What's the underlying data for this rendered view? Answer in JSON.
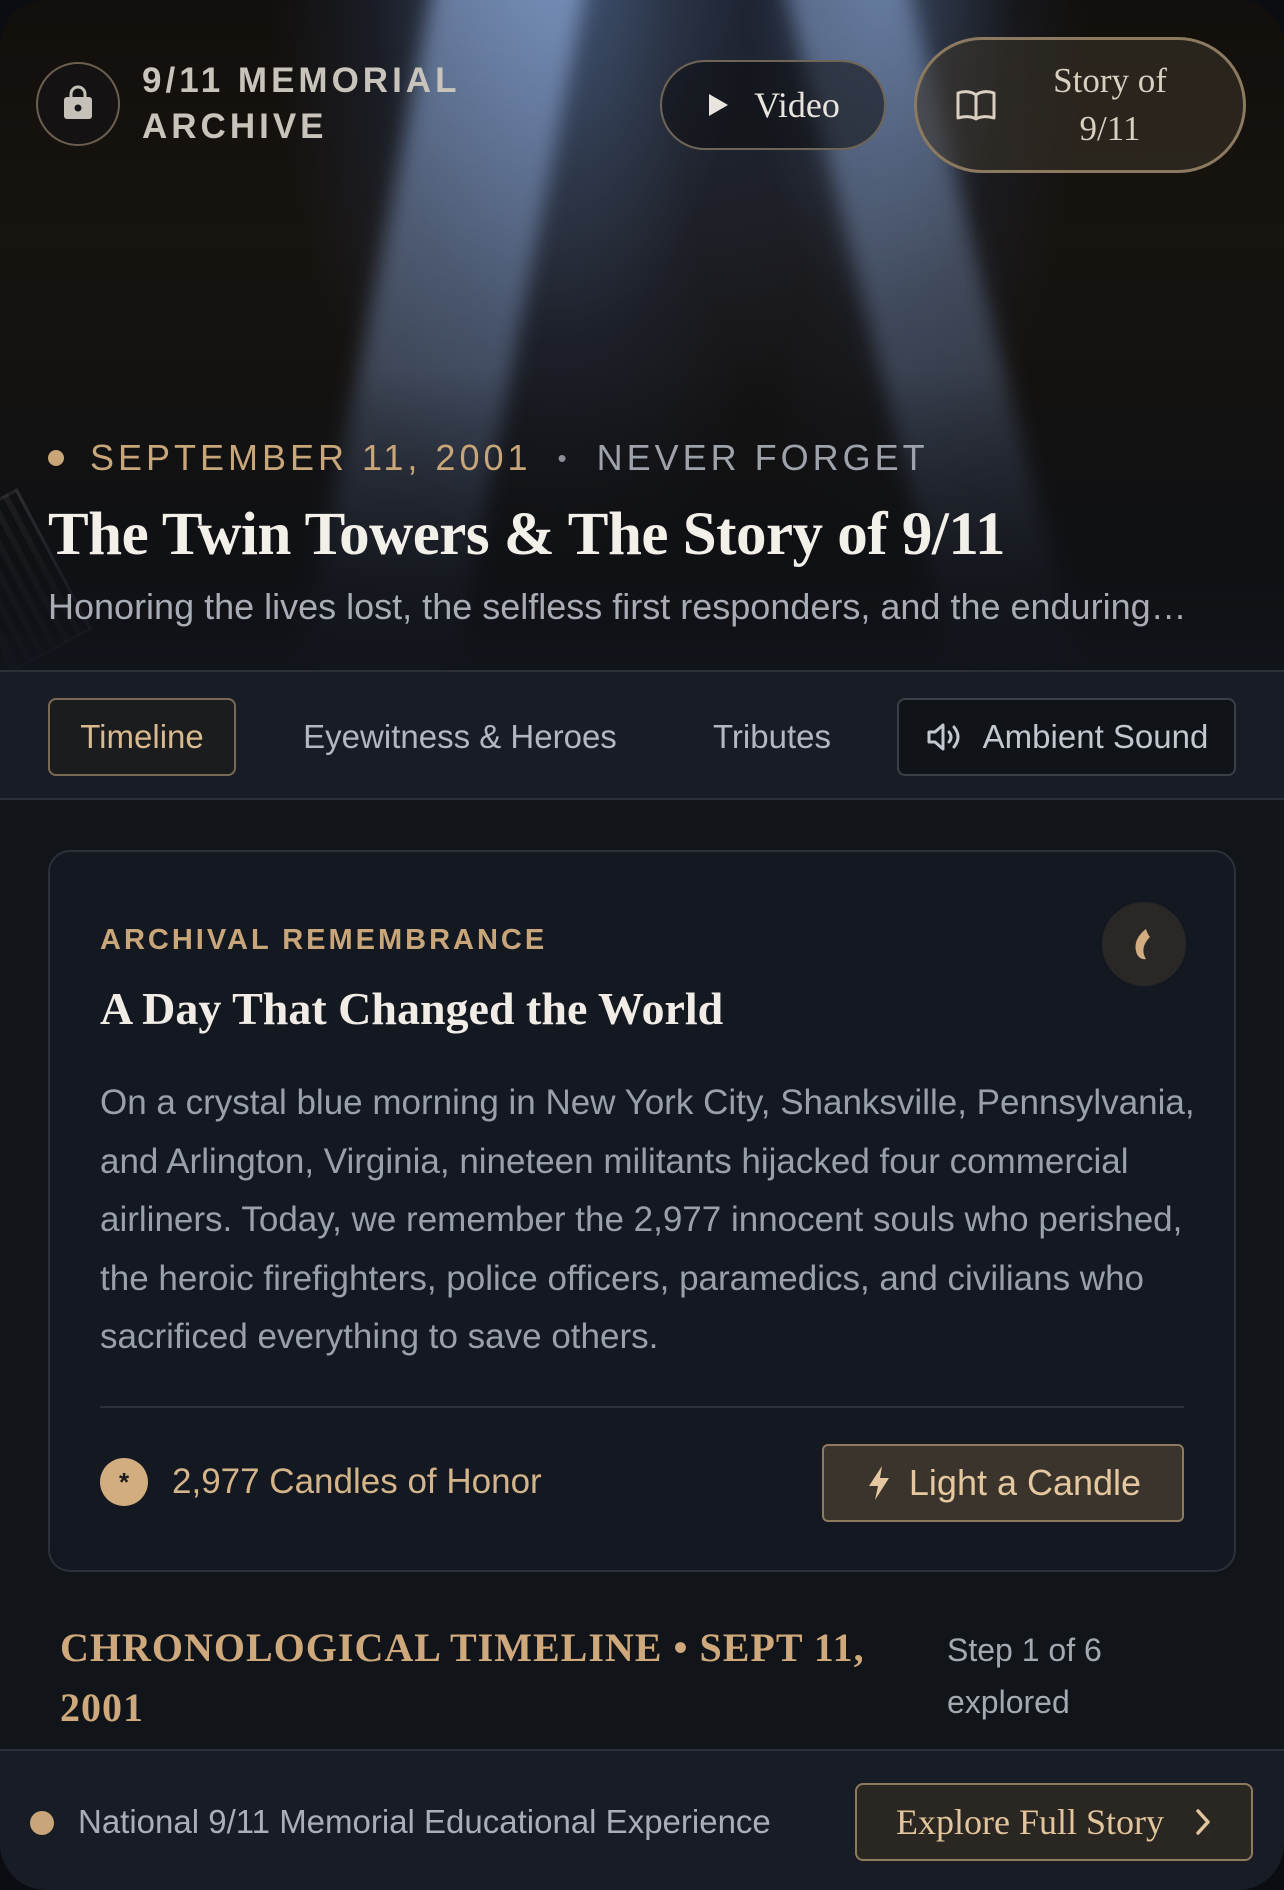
{
  "header": {
    "brand_line1": "9/11 MEMORIAL",
    "brand_line2": "ARCHIVE",
    "brand_icon": "bag-lock-icon",
    "video_label": "Video",
    "story_label_line1": "Story of",
    "story_label_line2": "9/11"
  },
  "hero": {
    "date": "SEPTEMBER 11, 2001",
    "separator": "•",
    "tag": "NEVER FORGET",
    "title": "The Twin Towers & The Story of 9/11",
    "subtitle": "Honoring the lives lost, the selfless first responders, and the enduring…"
  },
  "tabs": [
    {
      "label": "Timeline",
      "active": true
    },
    {
      "label": "Eyewitness & Heroes",
      "active": false
    },
    {
      "label": "Tributes",
      "active": false
    }
  ],
  "sound": {
    "label": "Ambient Sound",
    "icon": "speaker-icon"
  },
  "card": {
    "kicker": "ARCHIVAL REMEMBRANCE",
    "title": "A Day That Changed the World",
    "body": "On a crystal blue morning in New York City, Shanksville, Pennsylvania, and Arlington, Virginia, nineteen militants hijacked four commercial airliners. Today, we remember the 2,977 innocent souls who perished, the heroic firefighters, police officers, paramedics, and civilians who sacrificed everything to save others.",
    "candle_count_label": "2,977 Candles of Honor",
    "candle_dot_glyph": "*",
    "light_button": "Light a Candle"
  },
  "timeline": {
    "title": "CHRONOLOGICAL TIMELINE • SEPT 11, 2001",
    "step_text": "Step 1 of 6 explored"
  },
  "footer": {
    "text": "National 9/11 Memorial Educational Experience",
    "button": "Explore Full Story"
  },
  "colors": {
    "accent_gold": "#c8a67a",
    "background": "#111419",
    "panel": "#171c25"
  }
}
